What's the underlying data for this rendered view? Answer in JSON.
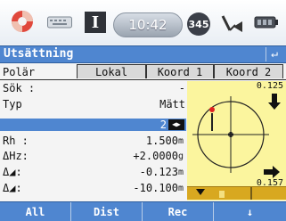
{
  "status_bar": {
    "time": "10:42",
    "badge_text": "345",
    "icons": [
      "lifebuoy-icon",
      "keyboard-icon",
      "input-mode-icon",
      "clock-icon",
      "satellite-badge-icon",
      "prism-icon",
      "battery-icon"
    ]
  },
  "title_bar": {
    "title": "Utsättning",
    "back_symbol": "↵"
  },
  "tabs": [
    "Polär",
    "Lokal",
    "Koord 1",
    "Koord 2"
  ],
  "form": {
    "sok_label": "Sök :",
    "sok_value": "-",
    "typ_label": "Typ",
    "typ_value": "Mätt",
    "selected_value": "2",
    "rows": [
      {
        "label": "Rh  :",
        "value": "1.500",
        "unit": "m"
      },
      {
        "label": "ΔHz:",
        "value": "+2.0000",
        "unit": "g"
      },
      {
        "label": "Δ◢:",
        "value": "-0.123",
        "unit": "m"
      },
      {
        "label": "Δ◢:",
        "value": "-10.100",
        "unit": "m"
      }
    ]
  },
  "guidance_panel": {
    "top_right_value": "0.125",
    "mid_right_value": "0.157",
    "target_icon": "crosshair-target-icon"
  },
  "softkeys": [
    "All",
    "Dist",
    "Rec",
    "↓"
  ],
  "colors": {
    "title_bar_blue": "#4f86d0",
    "panel_yellow": "#fbf59e",
    "panel_bar_orange": "#d8a820"
  }
}
